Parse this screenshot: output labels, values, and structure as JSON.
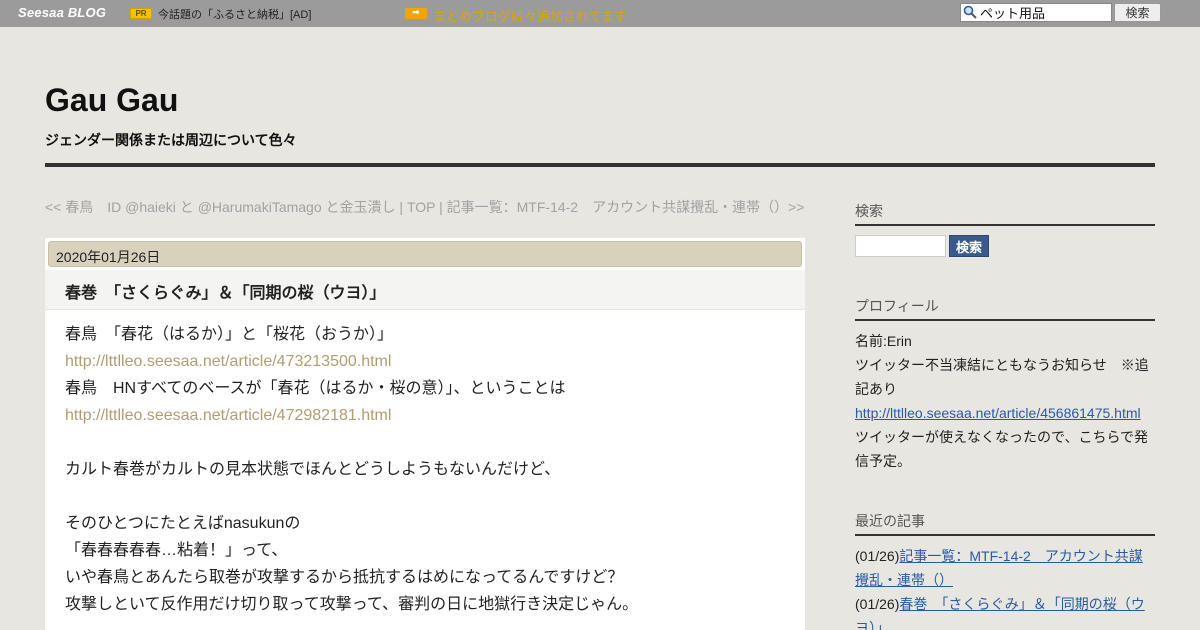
{
  "topbar": {
    "logo": "Seesaa BLOG",
    "pr_badge": "PR",
    "ad_text": "今話題の「ふるさと納税」[AD]",
    "news_text": "まとめブログ続々追加されてます",
    "search_value": "ペット用品",
    "search_button": "検索"
  },
  "header": {
    "title": "Gau Gau",
    "description": "ジェンダー関係または周辺について色々"
  },
  "article_nav": {
    "prev": "<< 春鳥　ID @haieki と @HarumakiTamago と金玉潰し",
    "sep1": " | ",
    "top": "TOP",
    "sep2": " | ",
    "next": "記事一覧：MTF-14-2　アカウント共謀攪乱・連帯（）>>"
  },
  "article": {
    "date": "2020年01月26日",
    "title": "春巻　「さくらぐみ」＆「同期の桜（ウヨ）」",
    "lines": [
      {
        "text": "春鳥　「春花（はるか）」と「桜花（おうか）」",
        "link": false
      },
      {
        "text": "http://lttlleo.seesaa.net/article/473213500.html",
        "link": true
      },
      {
        "text": "春鳥　HNすべてのベースが「春花（はるか・桜の意）」、ということは",
        "link": false
      },
      {
        "text": "http://lttlleo.seesaa.net/article/472982181.html",
        "link": true
      },
      {
        "text": "",
        "link": false
      },
      {
        "text": "カルト春巻がカルトの見本状態でほんとどうしようもないんだけど、",
        "link": false
      },
      {
        "text": "",
        "link": false
      },
      {
        "text": "そのひとつにたとえばnasukunの",
        "link": false
      },
      {
        "text": "「春春春春春…粘着！」って、",
        "link": false
      },
      {
        "text": "いや春鳥とあんたら取巻が攻撃するから抵抗するはめになってるんですけど？",
        "link": false
      },
      {
        "text": "攻撃しといて反作用だけ切り取って攻撃って、審判の日に地獄行き決定じゃん。",
        "link": false
      }
    ]
  },
  "sidebar": {
    "search_heading": "検索",
    "search_button": "検索",
    "profile_heading": "プロフィール",
    "profile_name": "名前:Erin",
    "profile_notice_1": "ツイッター不当凍結にともなうお知らせ　※追",
    "profile_notice_2": "記あり",
    "profile_link": "http://lttlleo.seesaa.net/article/456861475.html",
    "profile_note_1": "ツイッターが使えなくなったので、こちらで発",
    "profile_note_2": "信予定。",
    "recent_heading": "最近の記事",
    "recent": [
      {
        "date": "(01/26)",
        "title_1": "記事一覧：MTF-14-2　アカウント共謀",
        "title_2": "攪乱・連帯（）"
      },
      {
        "date": "(01/26)",
        "title_1": "春巻　「さくらぐみ」＆「同期の桜（ウ",
        "title_2": "ヨ）」"
      }
    ]
  }
}
